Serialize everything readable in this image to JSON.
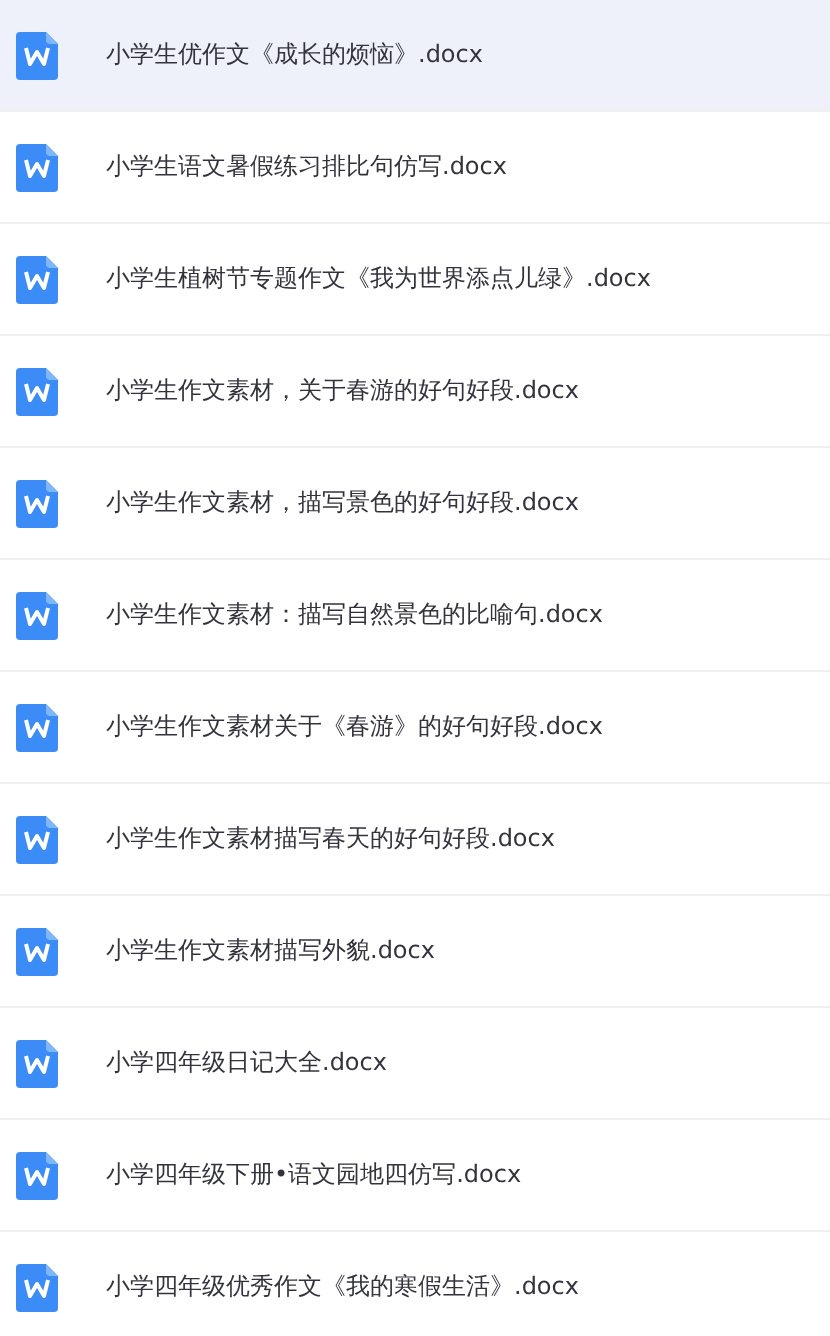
{
  "files": [
    {
      "name": "小学生优作文《成长的烦恼》.docx",
      "selected": true
    },
    {
      "name": "小学生语文暑假练习排比句仿写.docx",
      "selected": false
    },
    {
      "name": "小学生植树节专题作文《我为世界添点儿绿》.docx",
      "selected": false
    },
    {
      "name": "小学生作文素材，关于春游的好句好段.docx",
      "selected": false
    },
    {
      "name": "小学生作文素材，描写景色的好句好段.docx",
      "selected": false
    },
    {
      "name": "小学生作文素材：描写自然景色的比喻句.docx",
      "selected": false
    },
    {
      "name": "小学生作文素材关于《春游》的好句好段.docx",
      "selected": false
    },
    {
      "name": "小学生作文素材描写春天的好句好段.docx",
      "selected": false
    },
    {
      "name": "小学生作文素材描写外貌.docx",
      "selected": false
    },
    {
      "name": "小学四年级日记大全.docx",
      "selected": false
    },
    {
      "name": "小学四年级下册•语文园地四仿写.docx",
      "selected": false
    },
    {
      "name": "小学四年级优秀作文《我的寒假生活》.docx",
      "selected": false
    }
  ]
}
